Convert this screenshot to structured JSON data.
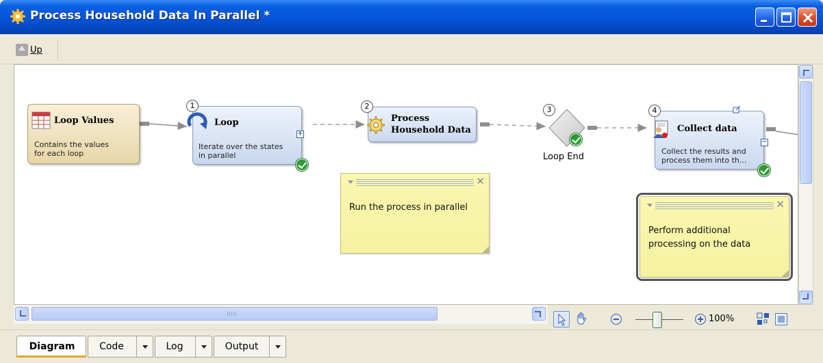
{
  "window": {
    "title": "Process Household Data In Parallel *"
  },
  "toolbar": {
    "up_label": "Up"
  },
  "nodes": {
    "loop_values": {
      "title": "Loop Values",
      "description_line1": "Contains the values",
      "description_line2": "for each loop"
    },
    "loop": {
      "number": "1",
      "title": "Loop",
      "description_line1": "Iterate over the states",
      "description_line2": "in parallel"
    },
    "process_household": {
      "number": "2",
      "title_line1": "Process",
      "title_line2": "Household Data"
    },
    "loop_end": {
      "number": "3",
      "label": "Loop End"
    },
    "collect_data": {
      "number": "4",
      "title": "Collect data",
      "description_line1": "Collect the results and",
      "description_line2": "process them into th..."
    }
  },
  "notes": [
    {
      "line1": "Run the process in parallel",
      "line2": ""
    },
    {
      "line1": "Perform additional",
      "line2": "processing on the data"
    }
  ],
  "zoom": {
    "value": "100%"
  },
  "tabs": [
    {
      "label": "Diagram",
      "active": true
    },
    {
      "label": "Code",
      "active": false
    },
    {
      "label": "Log",
      "active": false
    },
    {
      "label": "Output",
      "active": false
    }
  ],
  "colors": {
    "titlebar": "#0553d8",
    "node_fill": "#c9d8ef",
    "source_node_fill": "#e8d6a8",
    "note_fill": "#f5f2a0",
    "check_green": "#2e9b34",
    "active_tab_underline": "#f0a030"
  },
  "icons": {
    "app": "gear-icon",
    "up": "up-arrow-icon",
    "loop_values": "table-icon",
    "loop": "loop-arrow-icon",
    "process": "gear-process-icon",
    "collect": "person-document-icon",
    "pointer": "pointer-icon",
    "hand": "hand-icon"
  }
}
